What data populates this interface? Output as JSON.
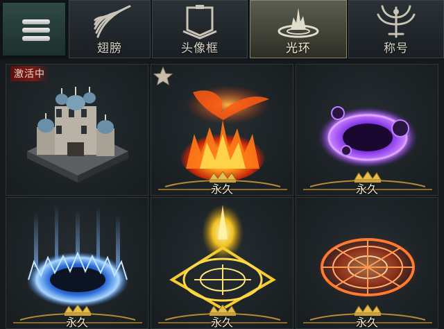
{
  "tabs": [
    {
      "label": "",
      "icon": "menu-icon"
    },
    {
      "label": "翅膀",
      "icon": "wings-icon"
    },
    {
      "label": "头像框",
      "icon": "avatar-frame-icon"
    },
    {
      "label": "光环",
      "icon": "aura-icon",
      "active": true
    },
    {
      "label": "称号",
      "icon": "title-emblem-icon"
    }
  ],
  "items": [
    {
      "name": "castle",
      "badge": "激活中",
      "duration": ""
    },
    {
      "name": "fire-phoenix-aura",
      "favorite": true,
      "duration": "永久"
    },
    {
      "name": "purple-vortex-aura",
      "duration": "永久"
    },
    {
      "name": "blue-frost-aura",
      "duration": "永久"
    },
    {
      "name": "golden-sigil-aura",
      "duration": "永久"
    },
    {
      "name": "red-magic-circle-aura",
      "duration": "永久"
    }
  ],
  "colors": {
    "accent": "#d7b24a",
    "active_tab": "#4d4f45",
    "badge": "#6e1612"
  }
}
